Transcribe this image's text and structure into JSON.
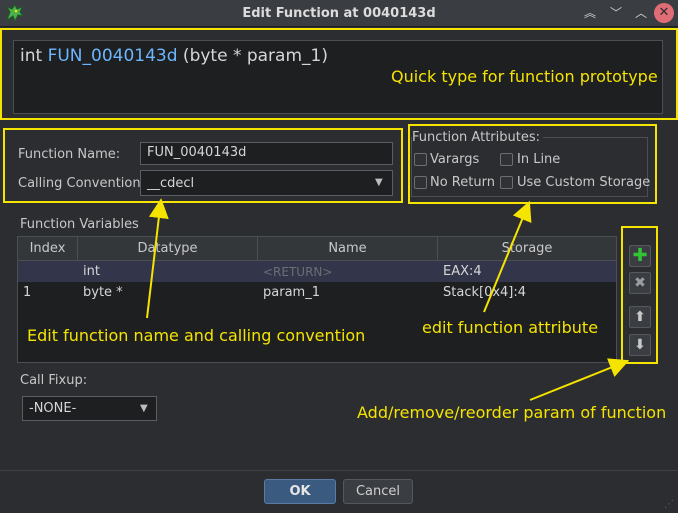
{
  "window": {
    "title": "Edit Function at 0040143d"
  },
  "prototype": {
    "return_type": "int ",
    "function_name": "FUN_0040143d",
    "params": " (byte * param_1)"
  },
  "form": {
    "function_name_label": "Function Name:",
    "function_name_value": "FUN_0040143d",
    "calling_convention_label": "Calling Convention",
    "calling_convention_value": "__cdecl"
  },
  "attributes": {
    "legend": "Function Attributes:",
    "varargs": "Varargs",
    "inline": "In Line",
    "no_return": "No Return",
    "custom_storage": "Use Custom Storage"
  },
  "variables": {
    "section_label": "Function Variables",
    "columns": [
      "Index",
      "Datatype",
      "Name",
      "Storage"
    ],
    "rows": [
      {
        "index": "",
        "datatype": "int",
        "name": "<RETURN>",
        "storage": "EAX:4"
      },
      {
        "index": "1",
        "datatype": "byte *",
        "name": "param_1",
        "storage": "Stack[0x4]:4"
      }
    ]
  },
  "fixup": {
    "label": "Call Fixup:",
    "value": "-NONE-"
  },
  "buttons": {
    "ok": "OK",
    "cancel": "Cancel"
  },
  "annotations": {
    "prototype_note": "Quick type for function prototype",
    "name_note": "Edit function name and calling convention",
    "attribute_note": "edit function attribute",
    "param_note": "Add/remove/reorder param of function"
  },
  "colors": {
    "annotation": "#f5e400",
    "function_name": "#6cb6ff",
    "ok_button": "#3b5a80",
    "add_icon": "#33c433"
  }
}
